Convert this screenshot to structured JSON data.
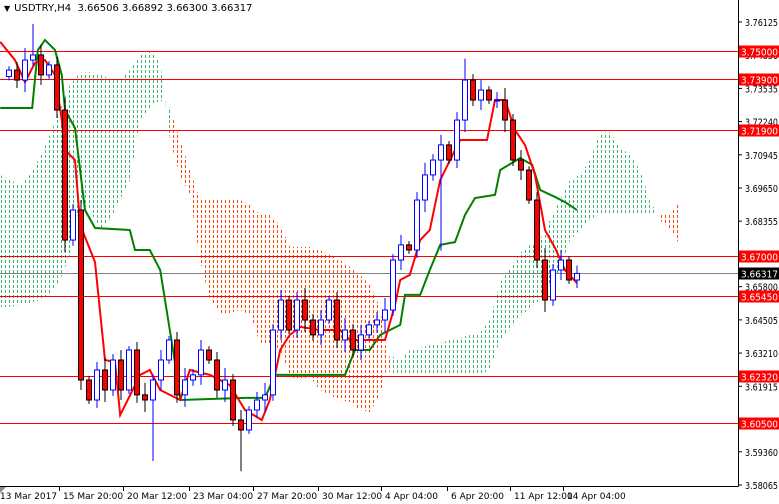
{
  "header": {
    "symbol": "USDTRY,H4",
    "ohlc": "3.66506 3.66892 3.66300 3.66317"
  },
  "chart_data": {
    "type": "candlestick",
    "title": "USDTRY,H4",
    "ylim": [
      3.58065,
      3.76125
    ],
    "y_ticks": [
      "3.76125",
      "3.74830",
      "3.73535",
      "3.72240",
      "3.70945",
      "3.69650",
      "3.68355",
      "3.65800",
      "3.64505",
      "3.63210",
      "3.61915",
      "3.59360",
      "3.58065"
    ],
    "x_ticks": [
      "13 Mar 2017",
      "15 Mar 20:00",
      "20 Mar 12:00",
      "23 Mar 04:00",
      "27 Mar 20:00",
      "30 Mar 12:00",
      "4 Apr 04:00",
      "6 Apr 20:00",
      "11 Apr 12:00",
      "14 Apr 04:00"
    ],
    "first_open": 3.74,
    "closes": [
      3.7425,
      3.7386,
      3.7464,
      3.7484,
      3.7406,
      3.7445,
      3.7269,
      3.6762,
      3.6879,
      3.6216,
      3.6138,
      3.6255,
      3.6177,
      3.6294,
      3.6177,
      3.6333,
      3.6158,
      3.6138,
      3.6216,
      3.6294,
      3.6372,
      3.6158,
      3.6216,
      3.6236,
      3.6333,
      3.6294,
      3.6177,
      3.6216,
      3.606,
      3.6021,
      3.6099,
      3.6138,
      3.6158,
      3.6411,
      3.6528,
      3.6411,
      3.6528,
      3.645,
      3.6392,
      3.645,
      3.6528,
      3.6372,
      3.6411,
      3.6333,
      3.6392,
      3.6431,
      3.645,
      3.6489,
      3.6684,
      3.6743,
      3.6723,
      3.6918,
      3.7016,
      3.7074,
      3.7133,
      3.7074,
      3.723,
      3.7386,
      3.7308,
      3.7347,
      3.7308,
      3.7308,
      3.723,
      3.7074,
      3.7035,
      3.6918,
      3.6684,
      3.6528,
      3.6645,
      3.6684,
      3.6606,
      3.66317
    ],
    "spikes": [
      {
        "bar": 3,
        "high": 3.7605
      },
      {
        "bar": 18,
        "low": 3.59
      },
      {
        "bar": 29,
        "low": 3.586
      },
      {
        "bar": 57,
        "high": 3.747
      },
      {
        "bar": 54,
        "low": 3.672
      }
    ],
    "tenkan": [
      [
        -1.1,
        3.7535
      ],
      [
        0.75,
        3.7464
      ],
      [
        2,
        3.7378
      ],
      [
        3.25,
        3.7453
      ],
      [
        4.5,
        3.7464
      ],
      [
        5.75,
        3.7406
      ],
      [
        6.6,
        3.723
      ],
      [
        7,
        3.7113
      ],
      [
        8.25,
        3.7074
      ],
      [
        8.9,
        3.6821
      ],
      [
        10.75,
        3.6676
      ],
      [
        12,
        3.6294
      ],
      [
        13.25,
        3.6286
      ],
      [
        13.9,
        3.6079
      ],
      [
        16.4,
        3.6236
      ],
      [
        17.6,
        3.6255
      ],
      [
        18.9,
        3.6177
      ],
      [
        21.4,
        3.6138
      ],
      [
        22.6,
        3.6255
      ],
      [
        25.1,
        3.6236
      ],
      [
        27.6,
        3.6196
      ],
      [
        29.5,
        3.6099
      ],
      [
        31.6,
        3.606
      ],
      [
        32.6,
        3.6138
      ],
      [
        33.9,
        3.6333
      ],
      [
        35.1,
        3.6392
      ],
      [
        36.4,
        3.6423
      ],
      [
        38.9,
        3.6411
      ],
      [
        41.4,
        3.6411
      ],
      [
        42.6,
        3.6372
      ],
      [
        47,
        3.6372
      ],
      [
        48.25,
        3.6509
      ],
      [
        48.9,
        3.6606
      ],
      [
        50.1,
        3.6626
      ],
      [
        51.4,
        3.6762
      ],
      [
        52.6,
        3.6801
      ],
      [
        53.9,
        3.6996
      ],
      [
        55.75,
        3.7113
      ],
      [
        56.4,
        3.7152
      ],
      [
        59.75,
        3.7152
      ],
      [
        60.75,
        3.7308
      ],
      [
        62,
        3.7308
      ],
      [
        63.25,
        3.7191
      ],
      [
        64.5,
        3.7133
      ],
      [
        65.75,
        3.7016
      ],
      [
        67,
        3.6801
      ],
      [
        68.25,
        3.6731
      ],
      [
        69.5,
        3.6645
      ],
      [
        71,
        3.6594
      ]
    ],
    "kijun": [
      [
        -1.1,
        3.7277
      ],
      [
        2.9,
        3.7277
      ],
      [
        3.6,
        3.7503
      ],
      [
        4.5,
        3.7542
      ],
      [
        5.75,
        3.7503
      ],
      [
        6.6,
        3.7406
      ],
      [
        7,
        3.7269
      ],
      [
        8.25,
        3.7199
      ],
      [
        9.5,
        3.6879
      ],
      [
        10.75,
        3.6809
      ],
      [
        15.1,
        3.6801
      ],
      [
        15.75,
        3.6723
      ],
      [
        17.6,
        3.6723
      ],
      [
        18.9,
        3.6645
      ],
      [
        21.1,
        3.6216
      ],
      [
        21.4,
        3.6138
      ],
      [
        29.5,
        3.6146
      ],
      [
        32,
        3.6146
      ],
      [
        33.25,
        3.6236
      ],
      [
        42,
        3.6236
      ],
      [
        43.25,
        3.6333
      ],
      [
        45.1,
        3.6333
      ],
      [
        46.4,
        3.6392
      ],
      [
        48.9,
        3.6431
      ],
      [
        49.5,
        3.6548
      ],
      [
        51.4,
        3.6548
      ],
      [
        52.6,
        3.6645
      ],
      [
        53.9,
        3.6743
      ],
      [
        55.75,
        3.6754
      ],
      [
        57,
        3.686
      ],
      [
        58.25,
        3.6926
      ],
      [
        60.75,
        3.6938
      ],
      [
        61.4,
        3.7035
      ],
      [
        63.9,
        3.7082
      ],
      [
        65.4,
        3.7055
      ],
      [
        66.4,
        3.6957
      ],
      [
        68.25,
        3.693
      ],
      [
        69.5,
        3.691
      ],
      [
        71,
        3.6879
      ]
    ],
    "cloud": {
      "start_bar": -1.125,
      "step_bars": 1.25,
      "span_a": [
        3.7016,
        3.6996,
        3.6977,
        3.7016,
        3.7086,
        3.7172,
        3.7269,
        3.7367,
        3.7414,
        3.7417,
        3.7406,
        3.7394,
        3.7386,
        3.7425,
        3.7484,
        3.7496,
        3.7464,
        3.7152,
        3.7016,
        3.6938,
        3.6684,
        3.6528,
        3.6477,
        3.6477,
        3.6489,
        3.647,
        3.636,
        3.636,
        3.6333,
        3.6228,
        3.6216,
        3.6228,
        3.6177,
        3.6157,
        3.6138,
        3.613,
        3.6099,
        3.6091,
        3.6157,
        3.6314,
        3.6294,
        3.6333,
        3.6341,
        3.6353,
        3.636,
        3.6372,
        3.638,
        3.6392,
        3.6399,
        3.645,
        3.6594,
        3.6653,
        3.6711,
        3.6743,
        3.6762,
        3.684,
        3.6918,
        3.6996,
        3.7016,
        3.7074,
        3.718,
        3.7183,
        3.7125,
        3.7094,
        3.7035,
        3.6918,
        3.684,
        3.6801,
        3.6743
      ],
      "span_b": [
        3.6501,
        3.6501,
        3.6509,
        3.6516,
        3.6528,
        3.6548,
        3.6606,
        3.6704,
        3.691,
        3.6879,
        3.6801,
        3.684,
        3.6918,
        3.6996,
        3.723,
        3.7277,
        3.7308,
        3.7277,
        3.7152,
        3.7035,
        3.6918,
        3.6918,
        3.6918,
        3.6918,
        3.6918,
        3.6899,
        3.686,
        3.686,
        3.6821,
        3.6735,
        3.6735,
        3.6735,
        3.6723,
        3.6704,
        3.6684,
        3.6657,
        3.6626,
        3.6587,
        3.6501,
        3.6236,
        3.6236,
        3.6236,
        3.6236,
        3.6236,
        3.6236,
        3.6236,
        3.6236,
        3.6236,
        3.6236,
        3.6255,
        3.6372,
        3.6411,
        3.6462,
        3.6497,
        3.6528,
        3.6587,
        3.6645,
        3.6762,
        3.6801,
        3.684,
        3.6867,
        3.686,
        3.686,
        3.686,
        3.686,
        3.686,
        3.686,
        3.686,
        3.6918
      ]
    },
    "levels": [
      {
        "price": 3.75,
        "label": "3.75000"
      },
      {
        "price": 3.739,
        "label": "3.73900"
      },
      {
        "price": 3.719,
        "label": "3.71900"
      },
      {
        "price": 3.67,
        "label": "3.67000"
      },
      {
        "price": 3.6545,
        "label": "3.65450"
      },
      {
        "price": 3.6232,
        "label": "3.62320"
      },
      {
        "price": 3.605,
        "label": "3.60500"
      }
    ],
    "current_price": {
      "price": 3.66317,
      "label": "3.66317"
    },
    "colors": {
      "bull": "#0000ff",
      "bear": "#ff0000",
      "tenkan": "#ff0000",
      "kijun": "#008000",
      "cloud_up": "#3cb371",
      "cloud_down": "#ff4500",
      "level": "#ff0000",
      "current": "#808080"
    }
  }
}
